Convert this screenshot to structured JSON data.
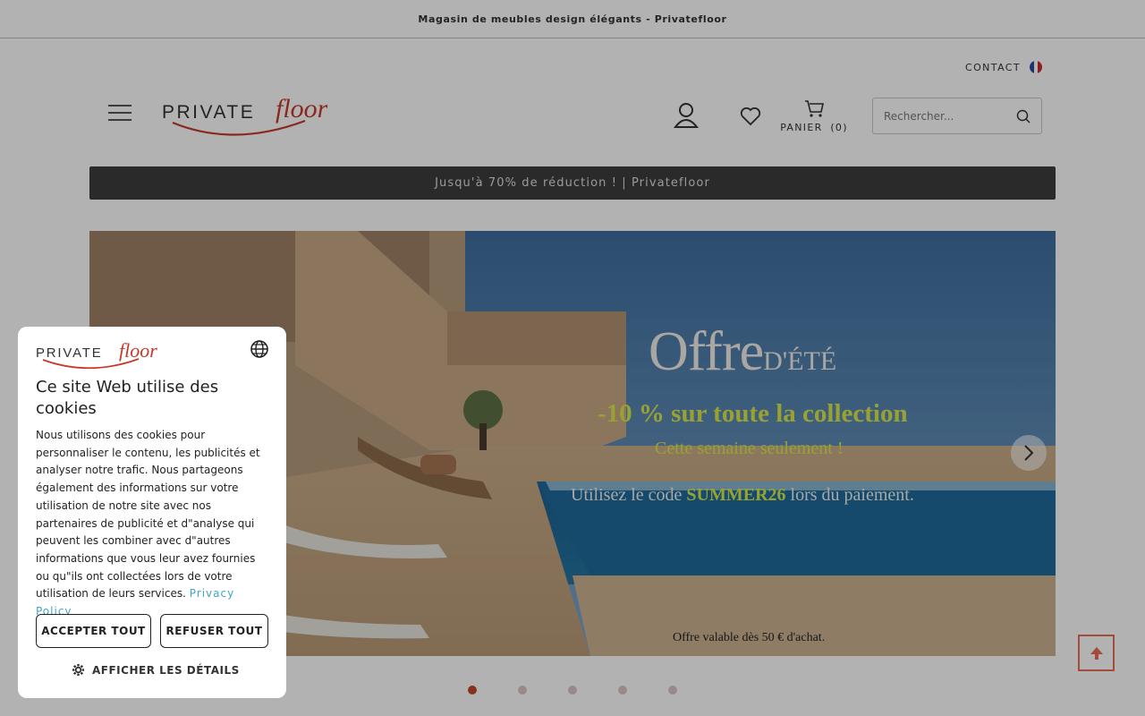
{
  "topbar": {
    "text": "Magasin de meubles design élégants - Privatefloor"
  },
  "header": {
    "contact_label": "CONTACT",
    "logo_alt": "PRIVATEfloor",
    "cart_label": "PANIER",
    "cart_count": "(0)",
    "search_placeholder": "Rechercher...",
    "icons": [
      "menu-icon",
      "user-icon",
      "heart-icon",
      "cart-icon",
      "search-icon",
      "france-flag-icon"
    ]
  },
  "promo_bar": {
    "text": "Jusqu'à 70% de réduction ! | Privatefloor"
  },
  "hero": {
    "title_main": "Offre",
    "title_small": "D'ÉTÉ",
    "line1": "-10 % sur toute la collection",
    "line2": "Cette semaine seulement !",
    "line3_prefix": "Utilisez le code",
    "line3_code": "SUMMER26",
    "line3_suffix": "lors du paiement.",
    "note": "Offre valable dès 50 € d'achat.",
    "slide_count": 5,
    "active_slide": 1
  },
  "cookie_banner": {
    "title": "Ce site Web utilise des cookies",
    "body": "Nous utilisons des cookies pour personnaliser le contenu, les publicités et analyser notre trafic. Nous partageons également des informations sur votre utilisation de notre site avec nos partenaires de publicité et d\"analyse qui peuvent les combiner avec d\"autres informations que vous leur avez fournies ou qu\"ils ont collectées lors de votre utilisation de leurs services.",
    "privacy_link": "Privacy Policy",
    "accept_label": "ACCEPTER TOUT",
    "refuse_label": "REFUSER TOUT",
    "details_label": "AFFICHER LES DÉTAILS"
  },
  "colors": {
    "accent": "#c2452b",
    "promo_bg": "#3d3d3d",
    "link": "#3fa5c3",
    "hero_highlight": "#d9e84a"
  }
}
